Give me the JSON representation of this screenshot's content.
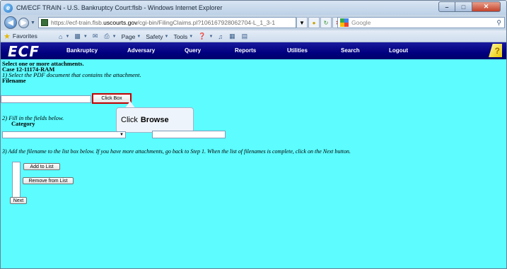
{
  "window": {
    "title": "CM/ECF TRAIN - U.S. Bankruptcy Court:flsb - Windows Internet Explorer",
    "controls": {
      "minimize": "–",
      "maximize": "□",
      "close": "✕"
    }
  },
  "address_bar": {
    "url_prefix": "https://ecf-train.flsb.",
    "url_host": "uscourts.gov",
    "url_path": "/cgi-bin/FilingClaims.pl?106167928062704-L_1_3-1"
  },
  "search": {
    "placeholder": "Google"
  },
  "command_bar": {
    "favorites_label": "Favorites",
    "page_label": "Page",
    "safety_label": "Safety",
    "tools_label": "Tools"
  },
  "ecf_nav": {
    "logo": "ECF",
    "items": [
      "Bankruptcy",
      "Adversary",
      "Query",
      "Reports",
      "Utilities",
      "Search",
      "Logout"
    ]
  },
  "form": {
    "heading": "Select one or more attachments.",
    "case_number": "Case 12-11174-RAM",
    "step1": "1) Select the PDF document that contains the attachment.",
    "filename_label": "Filename",
    "browse_button": "Click Box",
    "step2": "2) Fill in the fields below.",
    "category_label": "Category",
    "step3": "3) Add the filename to the list box below. If you have more attachments, go back to Step 1. When the list of filenames is complete, click on the Next button.",
    "add_button": "Add to List",
    "remove_button": "Remove from List",
    "next_button": "Next"
  },
  "callout": {
    "prefix": "Click",
    "emphasis": "Browse"
  },
  "colors": {
    "page_background": "#5cfcff",
    "nav_background": "#000080",
    "browse_highlight": "#c00000"
  }
}
